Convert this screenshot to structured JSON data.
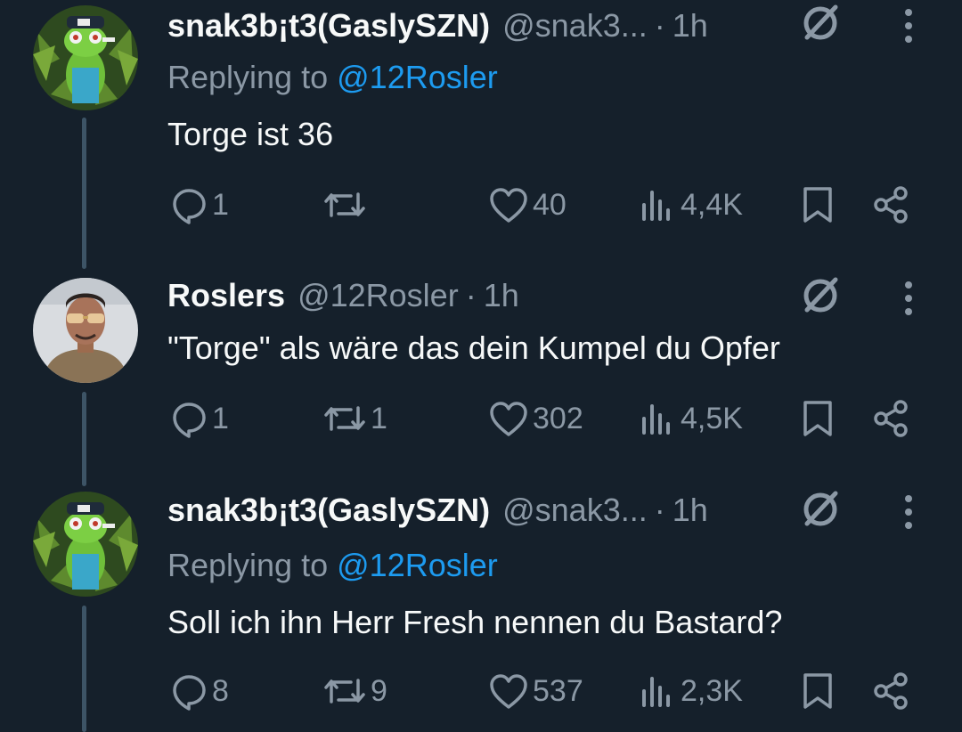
{
  "tweets": [
    {
      "name": "snak3b¡t3(GaslySZN)",
      "handle": "@snak3...",
      "dot": "·",
      "time": "1h",
      "replying_prefix": "Replying to",
      "replying_to": "@12Rosler",
      "text": "Torge ist 36",
      "replies": "1",
      "retweets": "",
      "likes": "40",
      "views": "4,4K",
      "avatar": "frog-avatar"
    },
    {
      "name": "Roslers",
      "handle": "@12Rosler",
      "dot": "·",
      "time": "1h",
      "text": "\"Torge\" als wäre das dein Kumpel du Opfer",
      "replies": "1",
      "retweets": "1",
      "likes": "302",
      "views": "4,5K",
      "avatar": "man-avatar"
    },
    {
      "name": "snak3b¡t3(GaslySZN)",
      "handle": "@snak3...",
      "dot": "·",
      "time": "1h",
      "replying_prefix": "Replying to",
      "replying_to": "@12Rosler",
      "text": "Soll ich ihn Herr Fresh nennen du Bastard?",
      "replies": "8",
      "retweets": "9",
      "likes": "537",
      "views": "2,3K",
      "avatar": "frog-avatar"
    }
  ],
  "colors": {
    "background": "#15202b",
    "text": "#f7f9f9",
    "muted": "#8b98a5",
    "accent": "#1d9bf0",
    "thread_line": "#3d5466"
  },
  "icons": [
    "reply-icon",
    "retweet-icon",
    "like-icon",
    "views-icon",
    "bookmark-icon",
    "share-icon",
    "grok-icon",
    "more-icon"
  ]
}
